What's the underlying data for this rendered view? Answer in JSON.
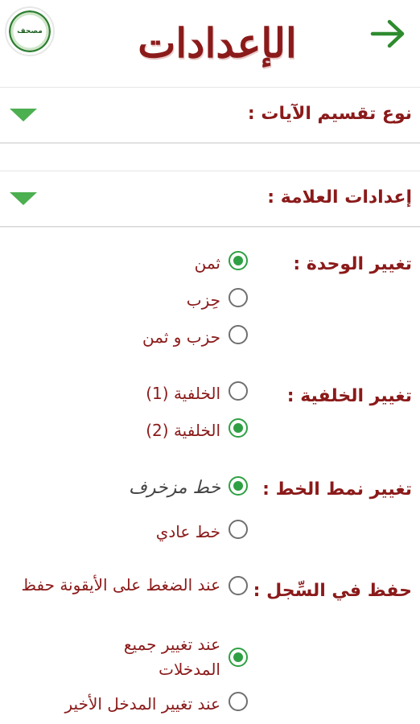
{
  "header": {
    "title": "الإعدادات",
    "logo_text": "مصحف",
    "back_icon": "arrow-right-icon"
  },
  "sections": [
    {
      "label": "نوع تقسيم الآيات :"
    },
    {
      "label": "إعدادات العلامة :"
    }
  ],
  "settings": {
    "unit": {
      "label": "تغيير الوحدة :",
      "options": [
        "ثمن",
        "حِزب",
        "حزب و ثمن"
      ],
      "selected": 0
    },
    "background": {
      "label": "تغيير الخلفية :",
      "options": [
        "الخلفية (1)",
        "الخلفية (2)"
      ],
      "selected": 1
    },
    "font": {
      "label": "تغيير نمط الخط :",
      "options": [
        "خط مزخرف",
        "خط عادي"
      ],
      "selected": 0
    },
    "save": {
      "label": "حفظ في السِّجل :",
      "options": [
        "عند الضغط على الأيقونة حفظ",
        "عند تغيير جميع المدخلات",
        "عند تغيير المدخل الأخير"
      ],
      "selected": 1
    }
  },
  "colors": {
    "accent": "#2ea043",
    "text": "#8b1a1a"
  }
}
